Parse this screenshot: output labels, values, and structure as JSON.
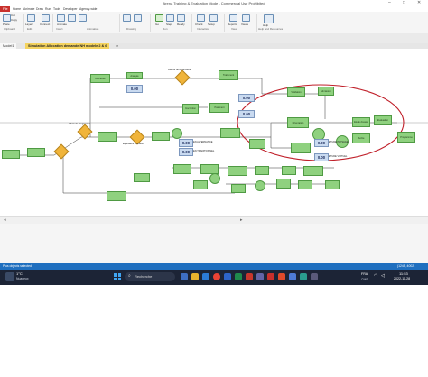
{
  "window": {
    "title": "Arena Training & Evaluation Mode - Commercial Use Prohibited",
    "controls": [
      "–",
      "□",
      "✕"
    ]
  },
  "ribbon": {
    "tabs": [
      "File",
      "Home",
      "Animate",
      "Draw",
      "Run",
      "Tools",
      "Developer",
      "Agency-wide"
    ],
    "items": [
      "Cut",
      "Copy",
      "Paste",
      "Layers",
      "Connect",
      "Animate",
      "Go",
      "Step",
      "Ready",
      "Check",
      "Setup",
      "Reports",
      "Views",
      "Help"
    ],
    "groups": [
      "Clipboard",
      "Edit",
      "Insert",
      "Animation",
      "Drawing",
      "Run",
      "Interaction",
      "View",
      "Help and Resources"
    ]
  },
  "document": {
    "tabs": [
      "Model1",
      "Simulation Allocation demande NH modele 2 & 6"
    ],
    "close_glyph": "×"
  },
  "model": {
    "counters": [
      "0.00",
      "0.00",
      "0.00",
      "0.00",
      "0.00",
      "0.00",
      "0.00"
    ],
    "labels": [
      "EN ALTERNANCE",
      "EN TRADITIONNEL",
      "ETUDE PAYSAGE",
      "ETUDE VIRTUEL"
    ],
    "decisions": [
      "Attente de la demande",
      "Choix du programme",
      "Equivalent formation"
    ],
    "process_blocks": [
      "Demande",
      "Analyse",
      "Traitement",
      "Validation",
      "Admission",
      "Inscription",
      "Paiement",
      "Orientation",
      "Etude dossier",
      "Evaluation",
      "Programme",
      "Sortie"
    ]
  },
  "status": {
    "left": "Plus objects selected",
    "right": "(1245, 4002)"
  },
  "taskbar": {
    "search_placeholder": "Recherche",
    "weather_temp": "1°C",
    "weather_text": "Nuageux",
    "lang": "FRA",
    "lang_sub": "CMS",
    "time": "11:53",
    "date": "2022-11-28"
  },
  "colors": {
    "accent": "#c9302c",
    "node_fill": "#8fd17f",
    "decision_fill": "#f0b43a",
    "highlight_ellipse": "#c0202a",
    "statusbar": "#1f6fbf",
    "taskbar": "#1c2436"
  }
}
